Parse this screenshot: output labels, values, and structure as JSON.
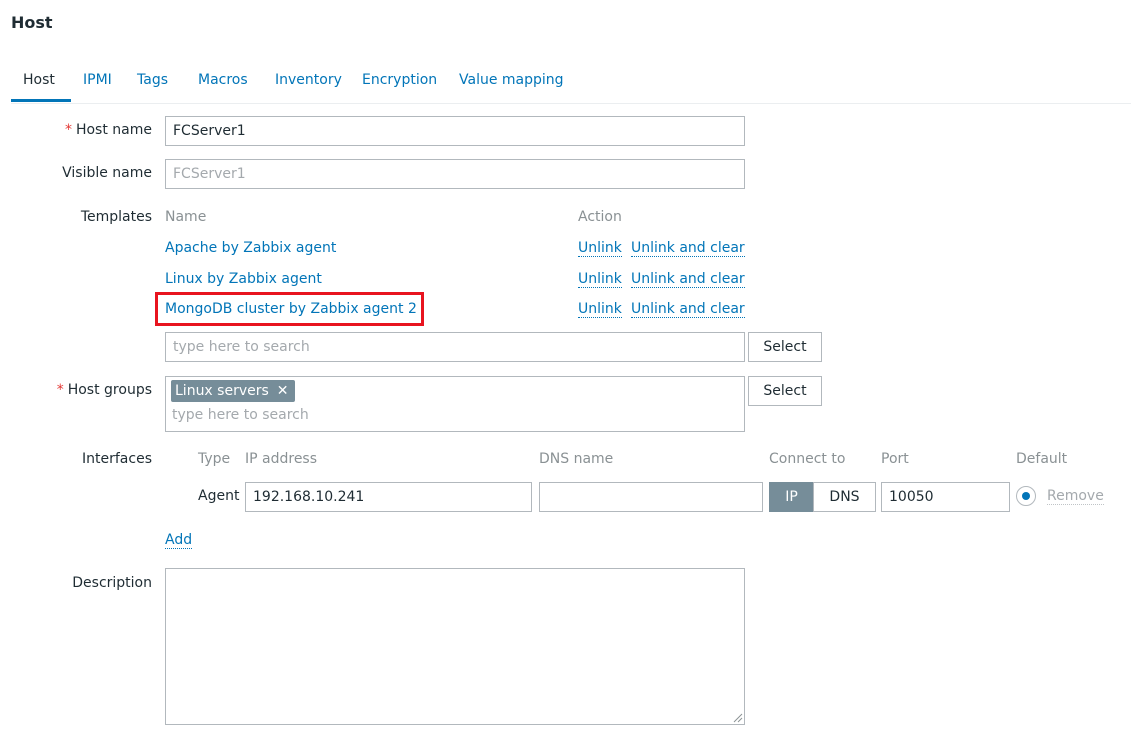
{
  "page": {
    "title": "Host"
  },
  "tabs": [
    "Host",
    "IPMI",
    "Tags",
    "Macros",
    "Inventory",
    "Encryption",
    "Value mapping"
  ],
  "form": {
    "host_name": {
      "label": "Host name",
      "required_mark": "*",
      "value": "FCServer1"
    },
    "visible_name": {
      "label": "Visible name",
      "value": "FCServer1"
    },
    "templates": {
      "label": "Templates",
      "col_name": "Name",
      "col_action": "Action",
      "items": [
        {
          "name": "Apache by Zabbix agent",
          "unlink": "Unlink",
          "unlink_clear": "Unlink and clear"
        },
        {
          "name": "Linux by Zabbix agent",
          "unlink": "Unlink",
          "unlink_clear": "Unlink and clear"
        },
        {
          "name": "MongoDB cluster by Zabbix agent 2",
          "unlink": "Unlink",
          "unlink_clear": "Unlink and clear"
        }
      ],
      "search_placeholder": "type here to search",
      "select_button": "Select"
    },
    "host_groups": {
      "label": "Host groups",
      "required_mark": "*",
      "chip": "Linux servers",
      "chip_remove": "✕",
      "search_placeholder": "type here to search",
      "select_button": "Select"
    },
    "interfaces": {
      "label": "Interfaces",
      "headers": {
        "type": "Type",
        "ip": "IP address",
        "dns": "DNS name",
        "connect": "Connect to",
        "port": "Port",
        "default": "Default"
      },
      "row": {
        "type": "Agent",
        "ip": "192.168.10.241",
        "dns": "",
        "connect_ip": "IP",
        "connect_dns": "DNS",
        "port": "10050",
        "remove": "Remove"
      },
      "add_link": "Add"
    },
    "description": {
      "label": "Description",
      "value": ""
    }
  },
  "colors": {
    "link": "#0275b8",
    "required": "#e33734",
    "chip_bg": "#768d99",
    "highlight": "#e8141f"
  }
}
